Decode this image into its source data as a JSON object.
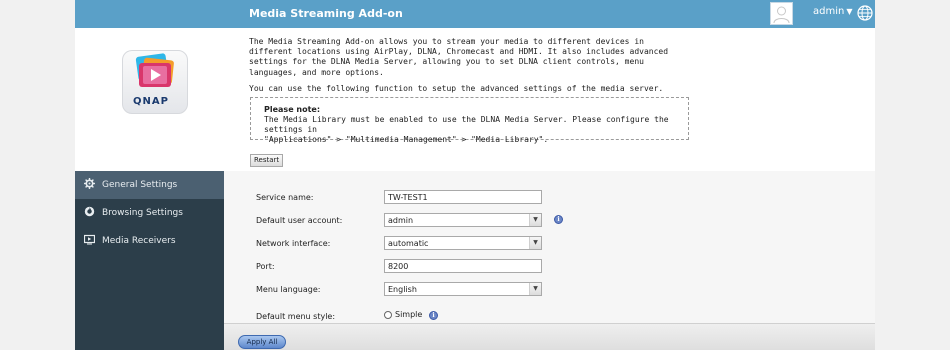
{
  "header": {
    "title": "Media Streaming Add-on",
    "user_label": "admin",
    "caret": "▼",
    "globe_icon": "globe-icon",
    "avatar_icon": "user-avatar-icon",
    "color": "#5aa0c8"
  },
  "logo": {
    "text": "QNAP"
  },
  "description": {
    "paragraph1": "The Media Streaming Add-on allows you to stream your media to different devices in different locations using AirPlay, DLNA, Chromecast and HDMI. It also includes advanced settings for the DLNA Media Server, allowing you to set DLNA client controls, menu languages, and more options.",
    "paragraph2": "You can use the following function to setup the advanced settings of the media server."
  },
  "note": {
    "title": "Please note:",
    "line1": "The Media Library must be enabled to use the DLNA Media Server. Please configure the settings in",
    "line2": "\"Applications\" > \"Multimedia Management\" > \"Media Library\"."
  },
  "buttons": {
    "restart": "Restart",
    "apply_all": "Apply All"
  },
  "sidebar": {
    "items": [
      {
        "label": "General Settings",
        "icon": "gear-icon",
        "active": true
      },
      {
        "label": "Browsing Settings",
        "icon": "browse-icon",
        "active": false
      },
      {
        "label": "Media Receivers",
        "icon": "monitor-icon",
        "active": false
      }
    ],
    "background": "#2c3e4a",
    "active_background": "#4b6071"
  },
  "form": {
    "service_name": {
      "label": "Service name:",
      "value": "TW-TEST1"
    },
    "default_user_account": {
      "label": "Default user account:",
      "value": "admin"
    },
    "network_interface": {
      "label": "Network interface:",
      "value": "automatic"
    },
    "port": {
      "label": "Port:",
      "value": "8200"
    },
    "menu_language": {
      "label": "Menu language:",
      "value": "English"
    },
    "default_menu_style": {
      "label": "Default menu style:",
      "option": "Simple"
    }
  }
}
